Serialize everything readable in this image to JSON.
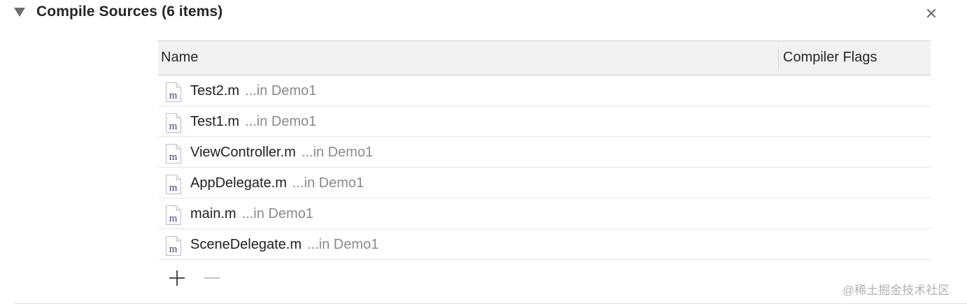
{
  "section": {
    "title": "Compile Sources (6 items)"
  },
  "table": {
    "columns": {
      "name": "Name",
      "flags": "Compiler Flags"
    },
    "rows": [
      {
        "file": "Test2.m",
        "location": "...in Demo1",
        "flags": ""
      },
      {
        "file": "Test1.m",
        "location": "...in Demo1",
        "flags": ""
      },
      {
        "file": "ViewController.m",
        "location": "...in Demo1",
        "flags": ""
      },
      {
        "file": "AppDelegate.m",
        "location": "...in Demo1",
        "flags": ""
      },
      {
        "file": "main.m",
        "location": "...in Demo1",
        "flags": ""
      },
      {
        "file": "SceneDelegate.m",
        "location": "...in Demo1",
        "flags": ""
      }
    ]
  },
  "file_icon_glyph": "m",
  "icons": {
    "disclosure": "disclosure-triangle-down-icon",
    "close": "close-x-icon",
    "file": "objc-source-file-icon",
    "add": "plus-icon",
    "remove": "minus-icon"
  },
  "colors": {
    "header_background": "#f2f2f2",
    "location_text": "#8a8a8a",
    "file_icon_letter": "#4a3a8c"
  },
  "watermark": "@稀土掘金技术社区"
}
